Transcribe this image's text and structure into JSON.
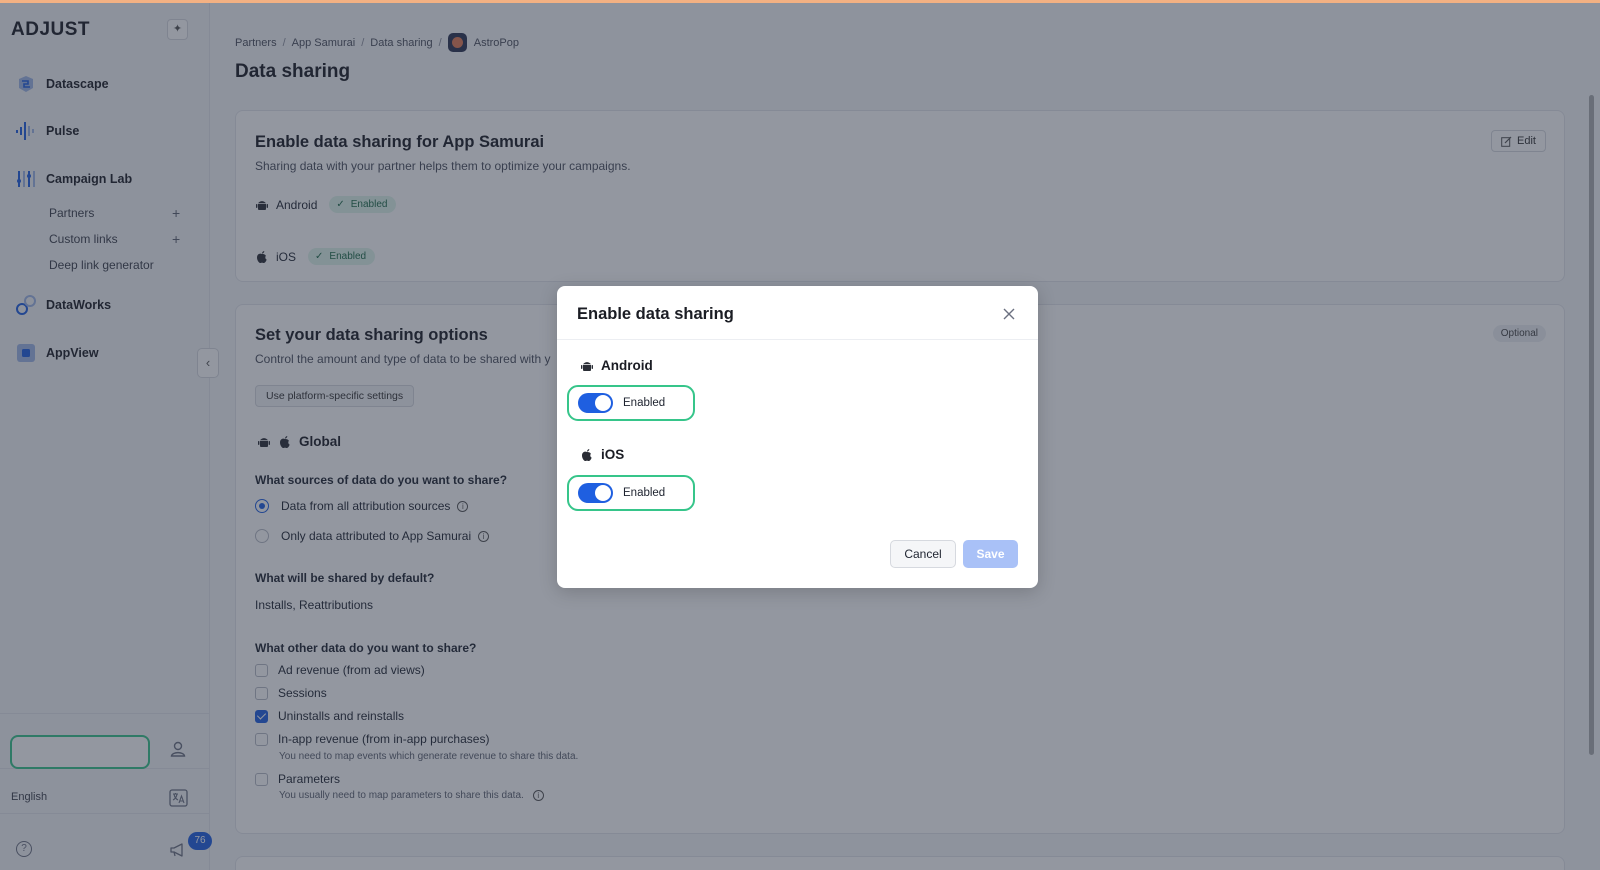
{
  "brand": {
    "logo": "ADJUST",
    "accent": "#1f5fe0",
    "highlight": "#36c58a"
  },
  "sidebar": {
    "nav": [
      {
        "label": "Datascape",
        "icon": "datascape-icon"
      },
      {
        "label": "Pulse",
        "icon": "pulse-icon"
      },
      {
        "label": "Campaign Lab",
        "icon": "campaign-lab-icon"
      },
      {
        "label": "DataWorks",
        "icon": "dataworks-icon"
      },
      {
        "label": "AppView",
        "icon": "appview-icon"
      }
    ],
    "campaign_lab_sub": [
      "Partners",
      "Custom links",
      "Deep link generator"
    ],
    "language": "English",
    "notifications_count": "76"
  },
  "breadcrumb": [
    "Partners",
    "App Samurai",
    "Data sharing",
    "AstroPop"
  ],
  "page": {
    "title": "Data sharing"
  },
  "enable_card": {
    "title": "Enable data sharing for App Samurai",
    "subtitle": "Sharing data with your partner helps them to optimize your campaigns.",
    "edit_label": "Edit",
    "platforms": [
      {
        "name": "Android",
        "status": "Enabled"
      },
      {
        "name": "iOS",
        "status": "Enabled"
      }
    ]
  },
  "options_card": {
    "title": "Set your data sharing options",
    "subtitle": "Control the amount and type of data to be shared with y",
    "badge": "Optional",
    "platform_button": "Use platform-specific settings",
    "global_label": "Global",
    "sources_question": "What sources of data do you want to share?",
    "sources": [
      {
        "label": "Data from all attribution sources",
        "selected": true
      },
      {
        "label": "Only data attributed to App Samurai",
        "selected": false
      }
    ],
    "default_question": "What will be shared by default?",
    "default_answer": "Installs, Reattributions",
    "other_question": "What other data do you want to share?",
    "other": [
      {
        "label": "Ad revenue (from ad views)",
        "checked": false
      },
      {
        "label": "Sessions",
        "checked": false
      },
      {
        "label": "Uninstalls and reinstalls",
        "checked": true
      },
      {
        "label": "In-app revenue (from in-app purchases)",
        "checked": false,
        "hint": "You need to map events which generate revenue to share this data."
      },
      {
        "label": "Parameters",
        "checked": false,
        "hint": "You usually need to map parameters to share this data."
      }
    ]
  },
  "modal": {
    "title": "Enable data sharing",
    "platforms": [
      {
        "name": "Android",
        "toggle_label": "Enabled",
        "on": true
      },
      {
        "name": "iOS",
        "toggle_label": "Enabled",
        "on": true
      }
    ],
    "cancel_label": "Cancel",
    "save_label": "Save"
  }
}
